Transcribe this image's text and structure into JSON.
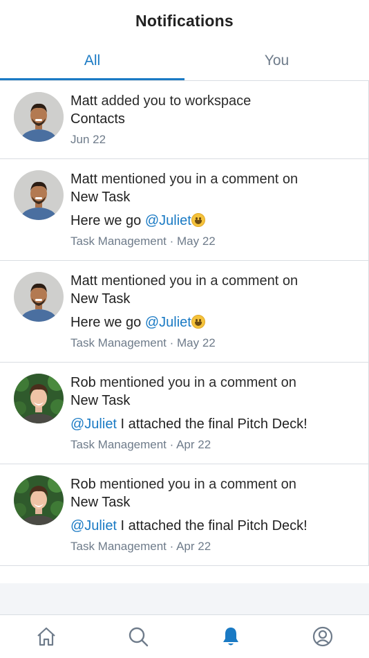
{
  "header": {
    "title": "Notifications"
  },
  "tabs": [
    {
      "label": "All",
      "active": true
    },
    {
      "label": "You",
      "active": false
    }
  ],
  "notifications": [
    {
      "avatar": "matt-avatar",
      "name": "Matt",
      "action": " added you to workspace",
      "target": "Contacts",
      "message": null,
      "meta": "Jun 22"
    },
    {
      "avatar": "matt-avatar",
      "name": "Matt",
      "action": " mentioned you in a comment on",
      "target": "New Task",
      "message": {
        "pre": "Here we go ",
        "mention": "@Juliet",
        "post": "",
        "emoji": "smile-emoji"
      },
      "meta": "Task Management · May 22"
    },
    {
      "avatar": "matt-avatar",
      "name": "Matt",
      "action": " mentioned you in a comment on",
      "target": "New Task",
      "message": {
        "pre": "Here we go ",
        "mention": "@Juliet",
        "post": "",
        "emoji": "smile-emoji"
      },
      "meta": "Task Management · May 22"
    },
    {
      "avatar": "rob-avatar",
      "name": "Rob",
      "action": " mentioned you in a comment on",
      "target": "New Task",
      "message": {
        "pre": "",
        "mention": "@Juliet",
        "post": " I attached the final Pitch Deck!"
      },
      "meta": "Task Management · Apr 22"
    },
    {
      "avatar": "rob-avatar",
      "name": "Rob",
      "action": " mentioned you in a comment on",
      "target": "New Task",
      "message": {
        "pre": "",
        "mention": "@Juliet",
        "post": " I attached the final Pitch Deck!"
      },
      "meta": "Task Management · Apr 22"
    }
  ],
  "bottom_nav": [
    {
      "icon": "home-icon",
      "active": false
    },
    {
      "icon": "search-icon",
      "active": false
    },
    {
      "icon": "bell-icon",
      "active": true
    },
    {
      "icon": "profile-icon",
      "active": false
    }
  ],
  "colors": {
    "accent": "#1a7ac4",
    "muted": "#6e7b8a",
    "divider": "#d9dde2"
  }
}
